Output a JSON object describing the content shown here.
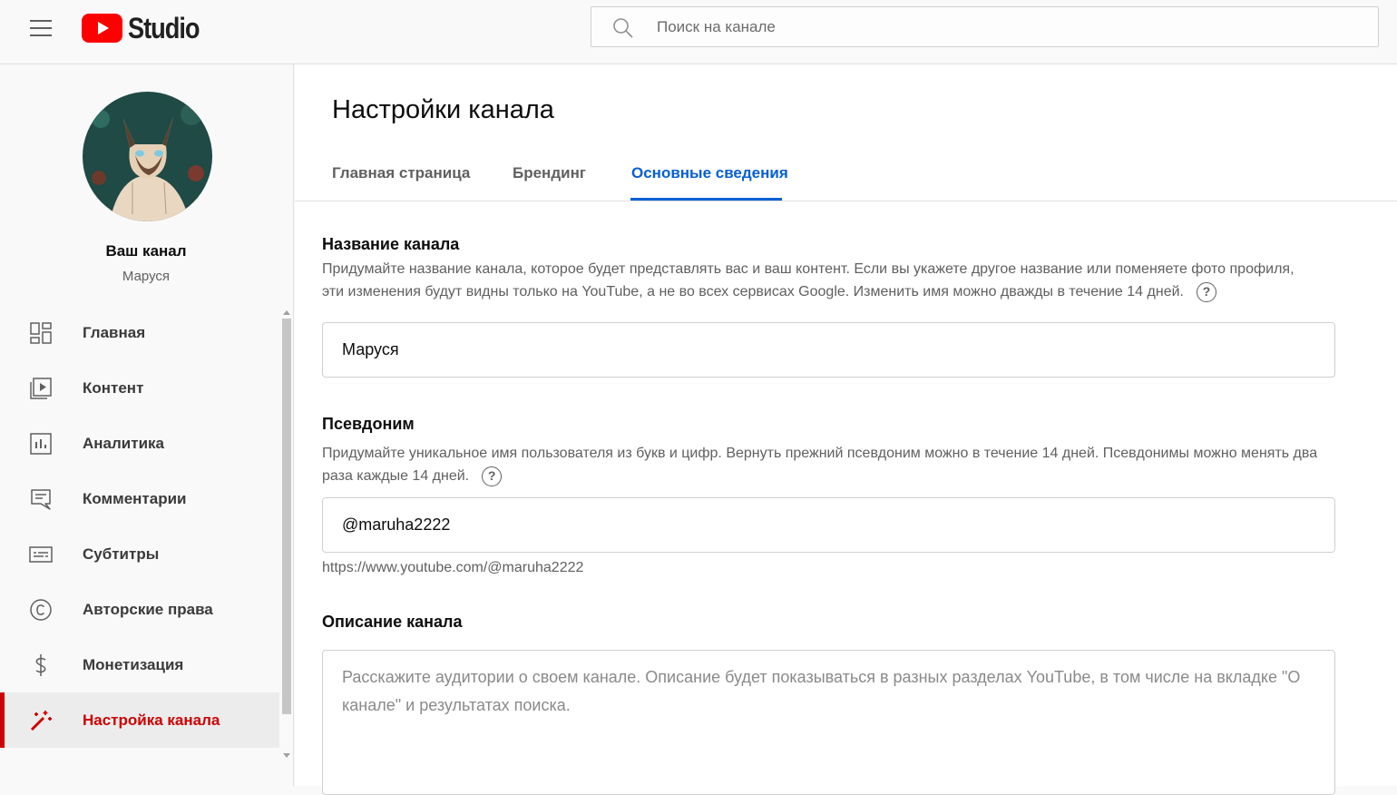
{
  "header": {
    "logo_text": "Studio",
    "search_placeholder": "Поиск на канале"
  },
  "sidebar": {
    "channel_title": "Ваш канал",
    "channel_name": "Маруся",
    "items": [
      {
        "label": "Главная",
        "icon": "dashboard-icon"
      },
      {
        "label": "Контент",
        "icon": "content-icon"
      },
      {
        "label": "Аналитика",
        "icon": "analytics-icon"
      },
      {
        "label": "Комментарии",
        "icon": "comments-icon"
      },
      {
        "label": "Субтитры",
        "icon": "subtitles-icon"
      },
      {
        "label": "Авторские права",
        "icon": "copyright-icon"
      },
      {
        "label": "Монетизация",
        "icon": "monetization-icon"
      },
      {
        "label": "Настройка канала",
        "icon": "customization-wand-icon",
        "active": true
      }
    ]
  },
  "main": {
    "page_title": "Настройки канала",
    "tabs": [
      {
        "label": "Главная страница"
      },
      {
        "label": "Брендинг"
      },
      {
        "label": "Основные сведения",
        "active": true
      }
    ],
    "name_section": {
      "title": "Название канала",
      "description": "Придумайте название канала, которое будет представлять вас и ваш контент. Если вы укажете другое название или поменяете фото профиля, эти изменения будут видны только на YouTube, а не во всех сервисах Google. Изменить имя можно дважды в течение 14 дней.",
      "value": "Маруся"
    },
    "handle_section": {
      "title": "Псевдоним",
      "description": "Придумайте уникальное имя пользователя из букв и цифр. Вернуть прежний псевдоним можно в течение 14 дней. Псевдонимы можно менять два раза каждые 14 дней.",
      "value": "@maruha2222",
      "url": "https://www.youtube.com/@maruha2222"
    },
    "description_section": {
      "title": "Описание канала",
      "placeholder": "Расскажите аудитории о своем канале. Описание будет показываться в разных разделах YouTube, в том числе на вкладке \"О канале\" и результатах поиска."
    }
  },
  "colors": {
    "accent_blue": "#065fd4",
    "active_red": "#cc0000",
    "youtube_red": "#ff0000"
  }
}
